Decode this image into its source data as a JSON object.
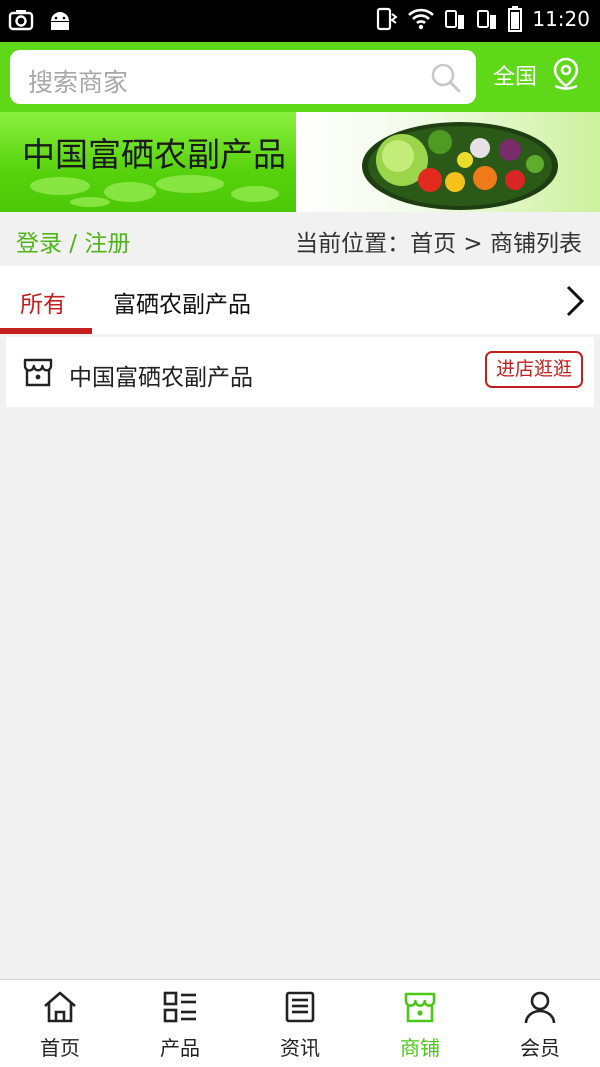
{
  "status_bar": {
    "time": "11:20"
  },
  "search": {
    "placeholder": "搜索商家"
  },
  "region": {
    "label": "全国"
  },
  "banner": {
    "title": "中国富硒农副产品"
  },
  "breadcrumb": {
    "login": "登录 / 注册",
    "location": "当前位置：首页 > 商铺列表"
  },
  "tabs": [
    {
      "label": "所有",
      "active": true
    },
    {
      "label": "富硒农副产品",
      "active": false
    }
  ],
  "shops": [
    {
      "name": "中国富硒农副产品",
      "action": "进店逛逛"
    }
  ],
  "tabbar": [
    {
      "label": "首页",
      "icon": "home-icon",
      "active": false
    },
    {
      "label": "产品",
      "icon": "grid-list-icon",
      "active": false
    },
    {
      "label": "资讯",
      "icon": "news-icon",
      "active": false
    },
    {
      "label": "商铺",
      "icon": "store-icon",
      "active": true
    },
    {
      "label": "会员",
      "icon": "user-icon",
      "active": false
    }
  ],
  "colors": {
    "brand_green": "#5ed818",
    "accent_red": "#c41f1f",
    "active_tab_green": "#4cc818",
    "link_green": "#4fb51b"
  }
}
